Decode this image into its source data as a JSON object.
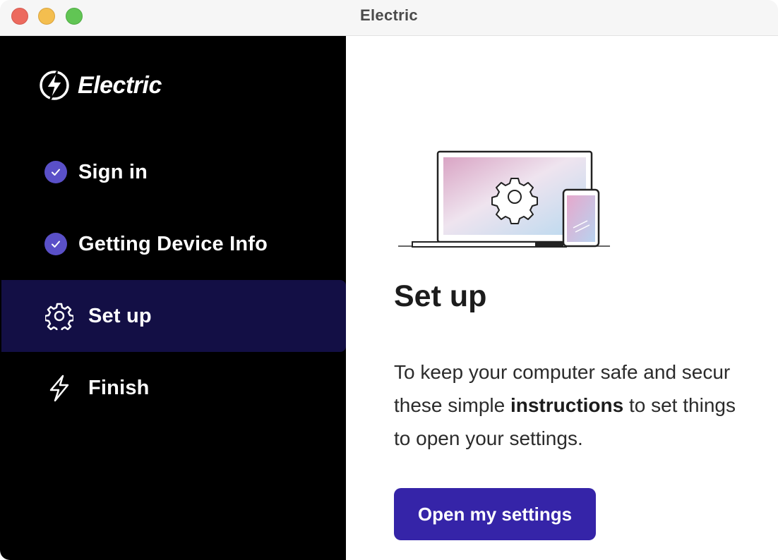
{
  "window": {
    "title": "Electric"
  },
  "sidebar": {
    "brand": "Electric",
    "steps": [
      {
        "label": "Sign in",
        "state": "completed",
        "icon": "check-icon"
      },
      {
        "label": "Getting Device Info",
        "state": "completed",
        "icon": "check-icon"
      },
      {
        "label": "Set up",
        "state": "active",
        "icon": "gear-icon"
      },
      {
        "label": "Finish",
        "state": "pending",
        "icon": "lightning-icon"
      }
    ]
  },
  "main": {
    "heading": "Set up",
    "body": {
      "line1": "To keep your computer safe and secur",
      "line2_pre": "these simple ",
      "line2_bold": "instructions",
      "line2_post": " to set things",
      "line3": "to open your settings."
    },
    "button_label": "Open my settings"
  },
  "colors": {
    "sidebar_bg": "#000000",
    "active_step_bg": "#130f45",
    "check_badge": "#5a50c8",
    "primary_button": "#3524a8"
  }
}
